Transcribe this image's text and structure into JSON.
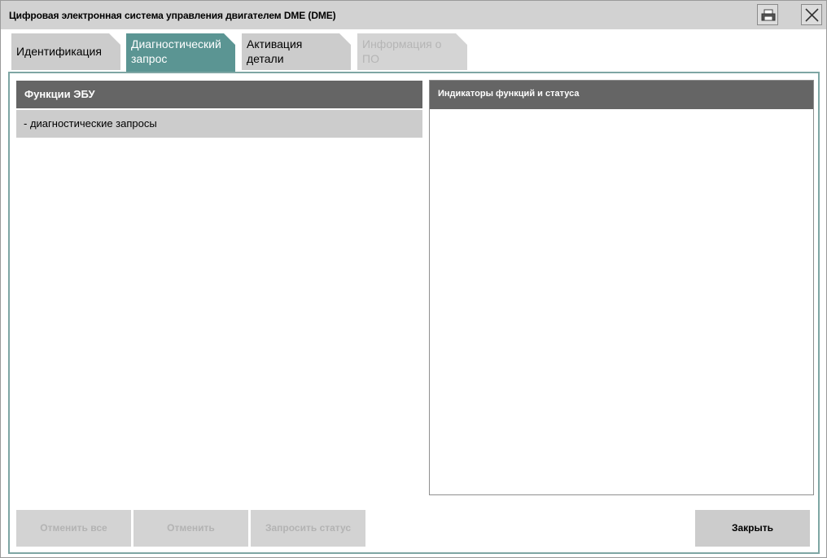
{
  "window": {
    "title": "Цифровая электронная система управления двигателем DME (DME)",
    "print_icon": "print-icon",
    "close_icon": "close-icon"
  },
  "tabs": [
    {
      "line1": "Идентификация",
      "line2": "",
      "state": "normal"
    },
    {
      "line1": "Диагностический",
      "line2": "запрос",
      "state": "active"
    },
    {
      "line1": "Активация",
      "line2": "детали",
      "state": "normal"
    },
    {
      "line1": "Информация о",
      "line2": "ПО",
      "state": "disabled"
    }
  ],
  "left_panel": {
    "header": "Функции ЭБУ",
    "items": [
      "- диагностические запросы"
    ]
  },
  "right_panel": {
    "header": "Индикаторы функций и статуса"
  },
  "buttons": {
    "cancel_all": "Отменить все",
    "cancel": "Отменить",
    "request_status": "Запросить статус",
    "close": "Закрыть"
  },
  "colors": {
    "active_tab": "#5b9593",
    "panel_header": "#656565",
    "content_border": "#7ea6a4"
  }
}
